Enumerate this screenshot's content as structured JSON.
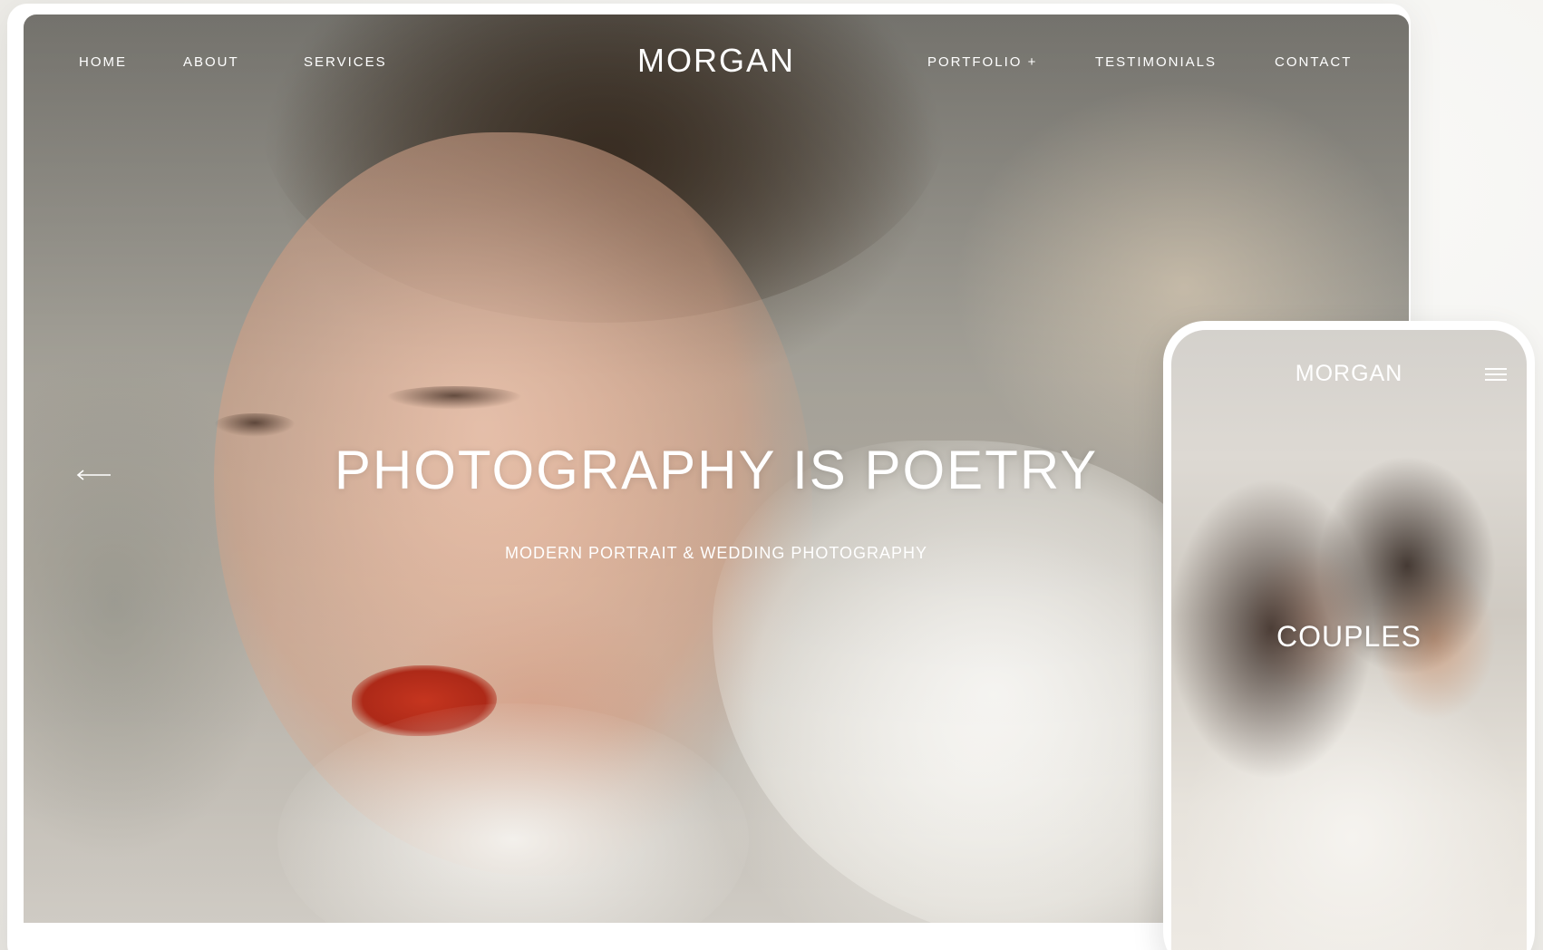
{
  "desktop": {
    "nav_left": [
      "HOME",
      "ABOUT",
      "SERVICES"
    ],
    "logo": "MORGAN",
    "nav_right": [
      "PORTFOLIO +",
      "TESTIMONIALS",
      "CONTACT"
    ],
    "hero_title": "PHOTOGRAPHY IS POETRY",
    "hero_subtitle": "MODERN PORTRAIT & WEDDING PHOTOGRAPHY",
    "prev_arrow_icon": "arrow-left-icon"
  },
  "mobile": {
    "logo": "MORGAN",
    "menu_icon": "hamburger-menu-icon",
    "category": "COUPLES"
  },
  "colors": {
    "nav_text": "#ffffff",
    "lip_accent": "#c8361f",
    "frame": "#ffffff"
  }
}
